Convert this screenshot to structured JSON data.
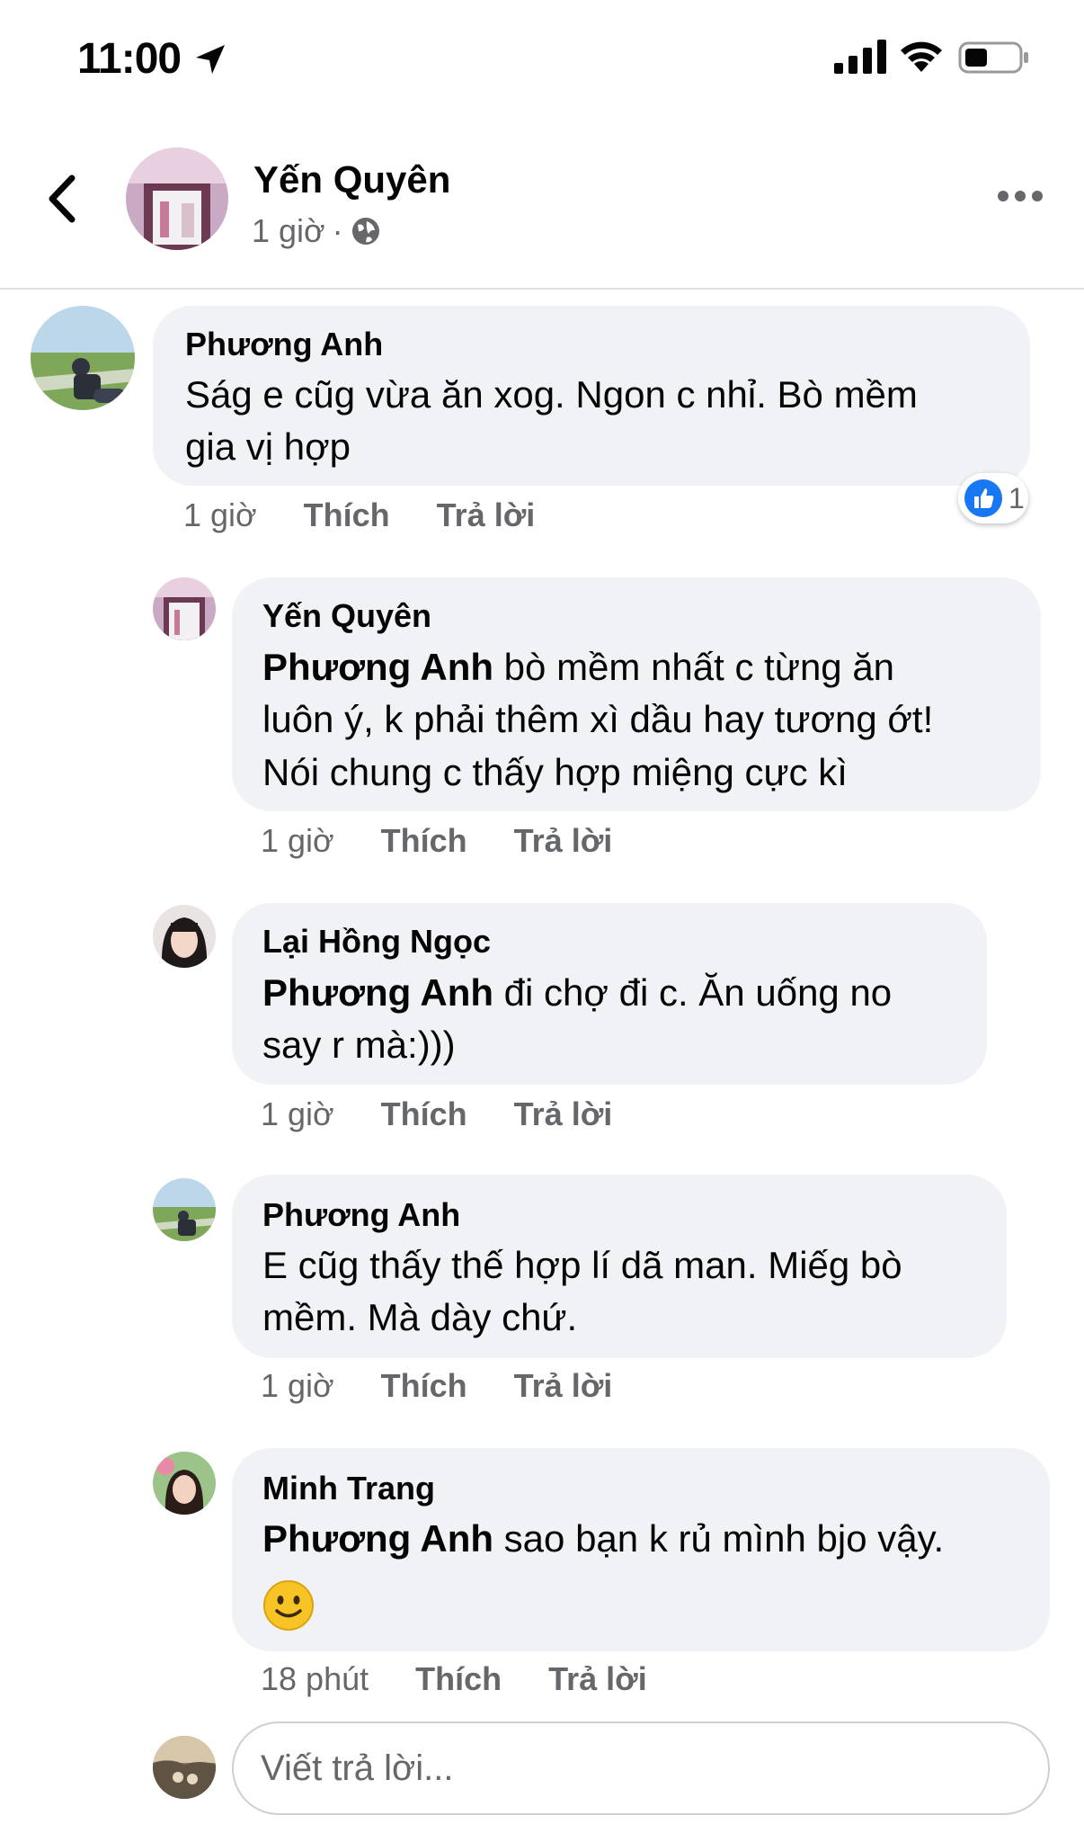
{
  "status_bar": {
    "time": "11:00"
  },
  "post": {
    "author": "Yến Quyên",
    "time": "1 giờ",
    "separator": "·"
  },
  "comments": [
    {
      "author": "Phương Anh",
      "lines": [
        "Ság e cũg vừa ăn xog. Ngon c nhỉ. Bò mềm",
        "gia vị hợp"
      ],
      "time": "1 giờ",
      "like": "Thích",
      "reply": "Trả lời",
      "reaction_count": "1"
    },
    {
      "author": "Yến Quyên",
      "mention": "Phương Anh",
      "lines": [
        " bò mềm nhất c từng ăn",
        "luôn ý, k phải thêm xì dầu hay tương ớt!",
        "Nói chung c thấy hợp miệng cực kì"
      ],
      "time": "1 giờ",
      "like": "Thích",
      "reply": "Trả lời"
    },
    {
      "author": "Lại Hồng Ngọc",
      "mention": "Phương Anh",
      "lines": [
        " đi chợ đi c. Ăn uống no",
        "say r mà:)))"
      ],
      "time": "1 giờ",
      "like": "Thích",
      "reply": "Trả lời"
    },
    {
      "author": "Phương Anh",
      "lines": [
        "E cũg thấy thế hợp lí dã man. Miếg bò",
        "mềm. Mà dày chứ."
      ],
      "time": "1 giờ",
      "like": "Thích",
      "reply": "Trả lời"
    },
    {
      "author": "Minh Trang",
      "mention": "Phương Anh",
      "lines": [
        "  sao bạn k rủ mình bjo vậy."
      ],
      "time": "18 phút",
      "like": "Thích",
      "reply": "Trả lời"
    }
  ],
  "reply_box": {
    "placeholder": "Viết trả lời..."
  },
  "colors": {
    "bubble": "#f0f2f5",
    "meta_text": "#65676b",
    "like_blue": "#1877f2"
  }
}
